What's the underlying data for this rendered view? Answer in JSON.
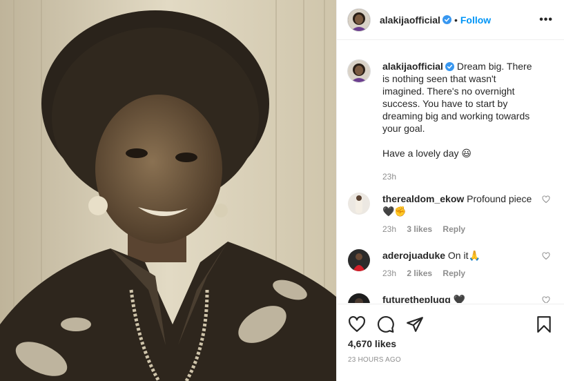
{
  "header": {
    "username": "alakijaofficial",
    "dot": "•",
    "follow_label": "Follow",
    "more_label": "•••"
  },
  "caption": {
    "username": "alakijaofficial",
    "text_1": "Dream big. There is nothing seen that wasn't imagined. There's no overnight success. You have to start by dreaming big and working towards your goal.",
    "text_2": "Have a lovely day 😃",
    "time": "23h"
  },
  "comments": [
    {
      "username": "therealdom_ekow",
      "text": "Profound piece 🖤✊",
      "time": "23h",
      "likes": "3 likes",
      "reply": "Reply"
    },
    {
      "username": "aderojuaduke",
      "text": "On it🙏",
      "time": "23h",
      "likes": "2 likes",
      "reply": "Reply"
    },
    {
      "username": "futuretheplugg",
      "text": "🖤"
    }
  ],
  "footer": {
    "likes": "4,670 likes",
    "time": "23 HOURS AGO"
  },
  "colors": {
    "accent": "#0095f6",
    "verified": "#3897f0",
    "muted": "#8e8e8e"
  }
}
